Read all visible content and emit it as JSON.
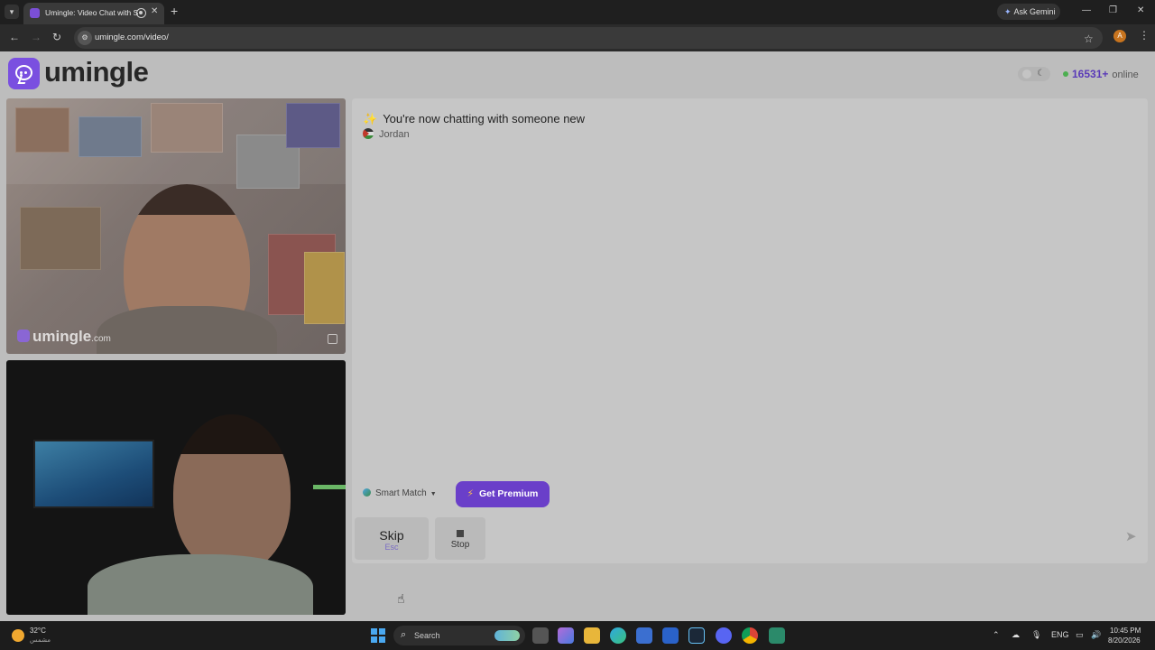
{
  "browser": {
    "tab_title": "Umingle: Video Chat with S",
    "ask_gemini": "Ask Gemini",
    "url": "umingle.com/video/",
    "profile_initial": "A"
  },
  "header": {
    "logo_text": "umingle",
    "online_count": "16531+",
    "online_label": "online"
  },
  "video": {
    "watermark": "umingle",
    "watermark_suffix": ".com"
  },
  "chat": {
    "system_message": "You're now chatting with someone new",
    "partner_country": "Jordan",
    "input_placeholder": ""
  },
  "controls": {
    "smart_match": "Smart Match",
    "get_premium": "Get Premium",
    "skip": "Skip",
    "skip_key": "Esc",
    "stop": "Stop"
  },
  "taskbar": {
    "temperature": "32°C",
    "weather_desc": "مشمس",
    "search_label": "Search",
    "language": "ENG",
    "time": "10:45 PM",
    "date": "8/20/2026"
  },
  "colors": {
    "brand_purple": "#6a3fc9",
    "online_green": "#4caf50"
  },
  "icons": [
    "search-icon",
    "star-icon",
    "moon-icon",
    "send-icon",
    "flag-icon",
    "bolt-icon",
    "globe-icon"
  ]
}
